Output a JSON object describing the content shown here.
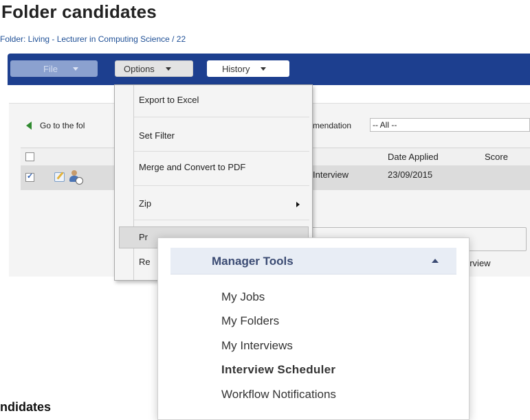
{
  "page": {
    "title": "Folder candidates",
    "folder_path": "Folder: Living - Lecturer in Computing Science / 22",
    "bottom_title": "ndidates"
  },
  "toolbar": {
    "file_label": "File",
    "options_label": "Options",
    "history_label": "History"
  },
  "filter": {
    "back_label": "Go to the fol",
    "recommendation_label": "mendation",
    "recommendation_value": "-- All --"
  },
  "grid": {
    "columns": {
      "date_applied": "Date Applied",
      "score": "Score"
    },
    "rows": [
      {
        "checked": true,
        "status": "Interview",
        "date_applied": "23/09/2015"
      }
    ]
  },
  "options_menu": {
    "items": [
      {
        "label": "Export to Excel"
      },
      {
        "label": "Set Filter"
      },
      {
        "label": "Merge and Convert to PDF"
      },
      {
        "label": "Zip"
      },
      {
        "label": "Pr"
      },
      {
        "label": "Re"
      }
    ]
  },
  "behind": {
    "interview_text": "erview"
  },
  "manager_tools": {
    "title": "Manager Tools",
    "links": [
      {
        "label": "My Jobs"
      },
      {
        "label": "My Folders"
      },
      {
        "label": "My Interviews"
      },
      {
        "label": "Interview Scheduler"
      },
      {
        "label": "Workflow Notifications"
      }
    ]
  },
  "colors": {
    "toolbar_bg": "#1d3f8f",
    "menu_bg": "#f4f4f4",
    "manager_header_bg": "#e8edf5",
    "manager_title": "#3b4b73",
    "link_blue": "#1e4f96"
  }
}
